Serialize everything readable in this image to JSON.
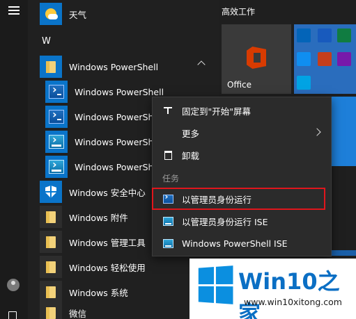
{
  "rail": {
    "menu": "menu-icon",
    "user": "user-icon",
    "docs": "documents-icon"
  },
  "applist": {
    "weather_label": "天气",
    "section_letter": "W",
    "folder_powershell": "Windows PowerShell",
    "powershell_items": [
      "Windows PowerShell",
      "Windows PowerShe",
      "Windows PowerShe",
      "Windows PowerShe"
    ],
    "security_center": "Windows 安全中心",
    "accessories": "Windows 附件",
    "admin_tools": "Windows 管理工具",
    "ease_of_access": "Windows 轻松使用",
    "system": "Windows 系统",
    "wechat": "微信"
  },
  "tiles": {
    "group_title": "高效工作",
    "office_label": "Office"
  },
  "context_menu": {
    "pin_start": "固定到\"开始\"屏幕",
    "more": "更多",
    "uninstall": "卸载",
    "tasks_header": "任务",
    "run_as_admin": "以管理员身份运行",
    "run_as_admin_ise": "以管理员身份运行 ISE",
    "ps_ise": "Windows PowerShell ISE"
  },
  "watermark": {
    "brand_a": "Win10",
    "brand_b": "之家",
    "url": "www.win10xitong.com"
  },
  "colors": {
    "highlight_red": "#e0161c",
    "tile_blue": "#1e7fd9",
    "menu_bg": "#2b2b2b",
    "brand_blue": "#0b6fc4"
  }
}
